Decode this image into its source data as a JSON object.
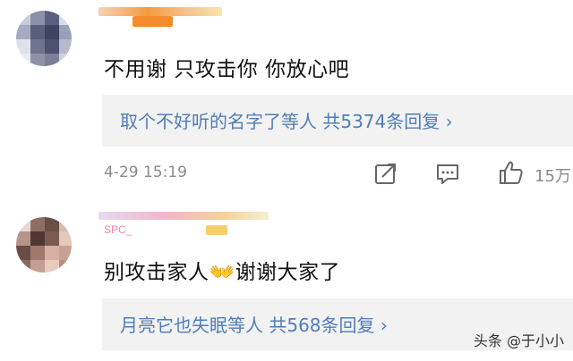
{
  "comments": [
    {
      "text": "不用谢 只攻击你 你放心吧",
      "replies_link": "取个不好听的名字了等人 共5374条回复 ›",
      "timestamp": "4-29 15:19",
      "like_count": "15万",
      "icons": {
        "share": "share-icon",
        "reply": "comment-icon",
        "like": "thumbs-up-icon"
      }
    },
    {
      "username_visible_fragment": "SPC_",
      "text": "别攻击家人👐谢谢大家了",
      "replies_link": "月亮它也失眠等人 共568条回复 ›"
    }
  ],
  "watermark": "头条 @于小小",
  "colors": {
    "link": "#4f7db9",
    "box": "#f2f2f2",
    "meta": "#8a8a8a",
    "text": "#111111"
  }
}
